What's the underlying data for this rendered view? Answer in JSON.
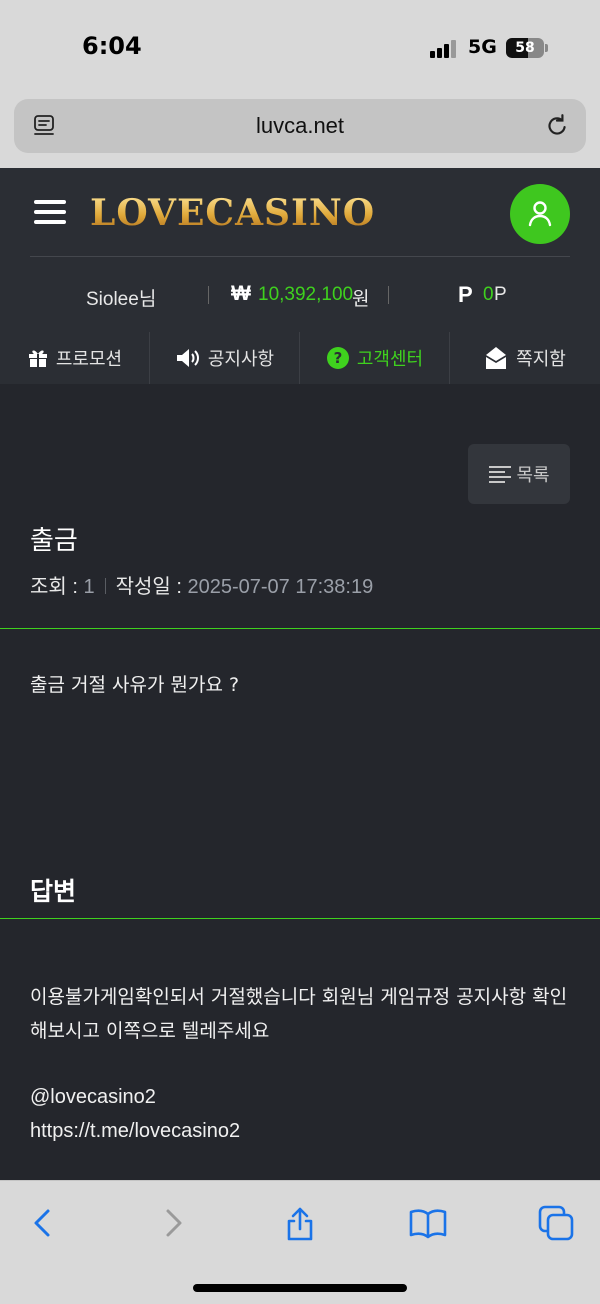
{
  "status_bar": {
    "time": "6:04",
    "network": "5G",
    "battery": "58",
    "battery_level": 0.58
  },
  "browser": {
    "url": "luvca.net"
  },
  "site": {
    "logo": "LOVECASINO",
    "user": {
      "name": "Siolee님",
      "currency_symbol": "₩",
      "money": "10,392,100",
      "money_unit": "원",
      "point_symbol": "P",
      "point": "0",
      "point_unit": "P"
    },
    "menu": [
      {
        "label": "프로모션",
        "icon": "gift-icon"
      },
      {
        "label": "공지사항",
        "icon": "speaker-icon"
      },
      {
        "label": "고객센터",
        "icon": "question-icon",
        "active": true
      },
      {
        "label": "쪽지함",
        "icon": "envelope-icon"
      }
    ]
  },
  "post": {
    "list_button": "목록",
    "title": "출금",
    "views_label": "조회 : ",
    "views": "1",
    "date_label": "작성일 : ",
    "date": "2025-07-07 17:38:19",
    "question": "출금 거절 사유가 뭔가요 ?",
    "answer_title": "답변",
    "answer_line1": "이용불가게임확인되서 거절했습니다 회원님 게임규정 공지사항 확인해보시고 이쪽으로 텔레주세요",
    "answer_handle": "@lovecasino2",
    "answer_link": "https://t.me/lovecasino2"
  },
  "colors": {
    "accent": "#3fd11e",
    "background": "#24262c",
    "header": "#2b2e34"
  }
}
